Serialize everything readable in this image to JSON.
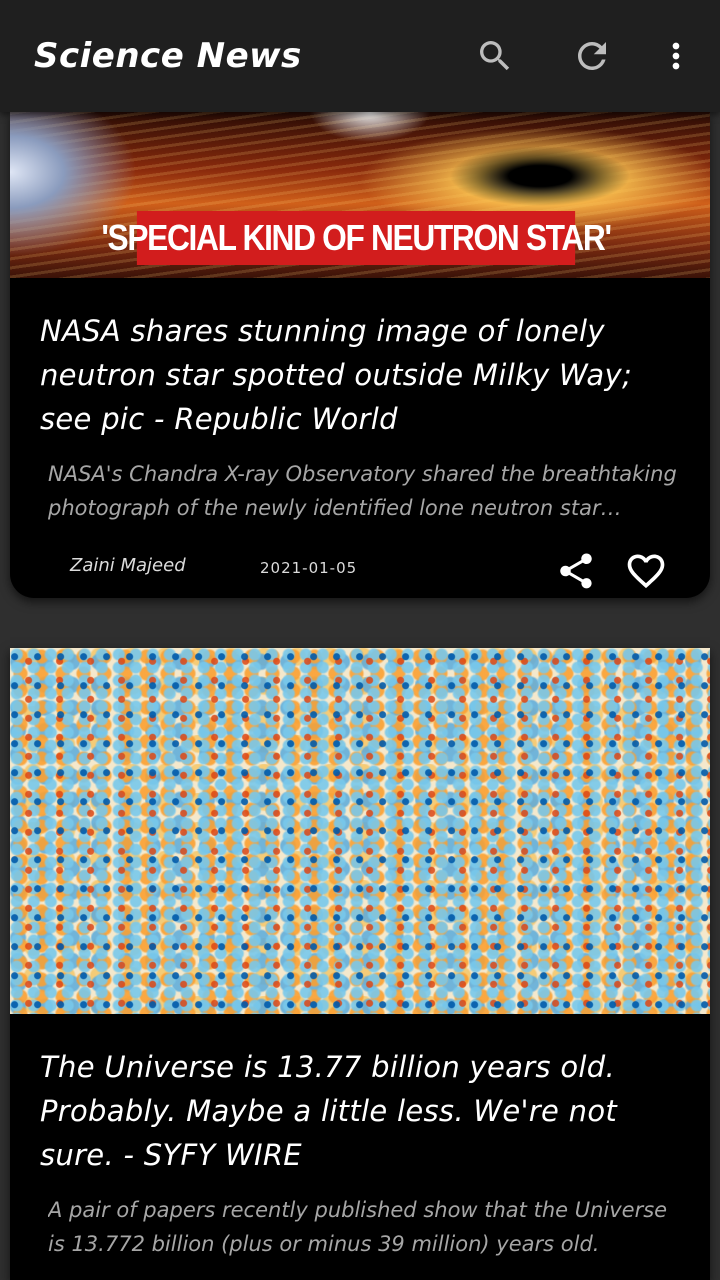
{
  "appbar": {
    "title": "Science News",
    "icons": [
      "search-icon",
      "refresh-icon",
      "more-vertical-icon"
    ]
  },
  "articles": [
    {
      "image_caption": "'SPECIAL KIND OF NEUTRON STAR'",
      "title": "NASA shares stunning image of lonely neutron star spotted outside Milky Way; see pic - Republic World",
      "description": "NASA's Chandra X-ray Observatory shared the breathtaking photograph of the newly identified lone neutron star spotted outside the Milky Way.",
      "author": "Zaini Majeed",
      "date": "2021-01-05",
      "actions": [
        "share-icon",
        "heart-outline-icon"
      ]
    },
    {
      "title": "The Universe is 13.77 billion years old. Probably. Maybe a little less. We're not sure. - SYFY WIRE",
      "description": "A pair of papers recently published show that the Universe is 13.772 billion (plus or minus 39 million) years old."
    }
  ],
  "colors": {
    "background": "#2f2f2f",
    "appbar": "#1f1f1f",
    "card": "#000000",
    "banner_red": "#d21d1d",
    "description_text": "#a6a6a6"
  }
}
